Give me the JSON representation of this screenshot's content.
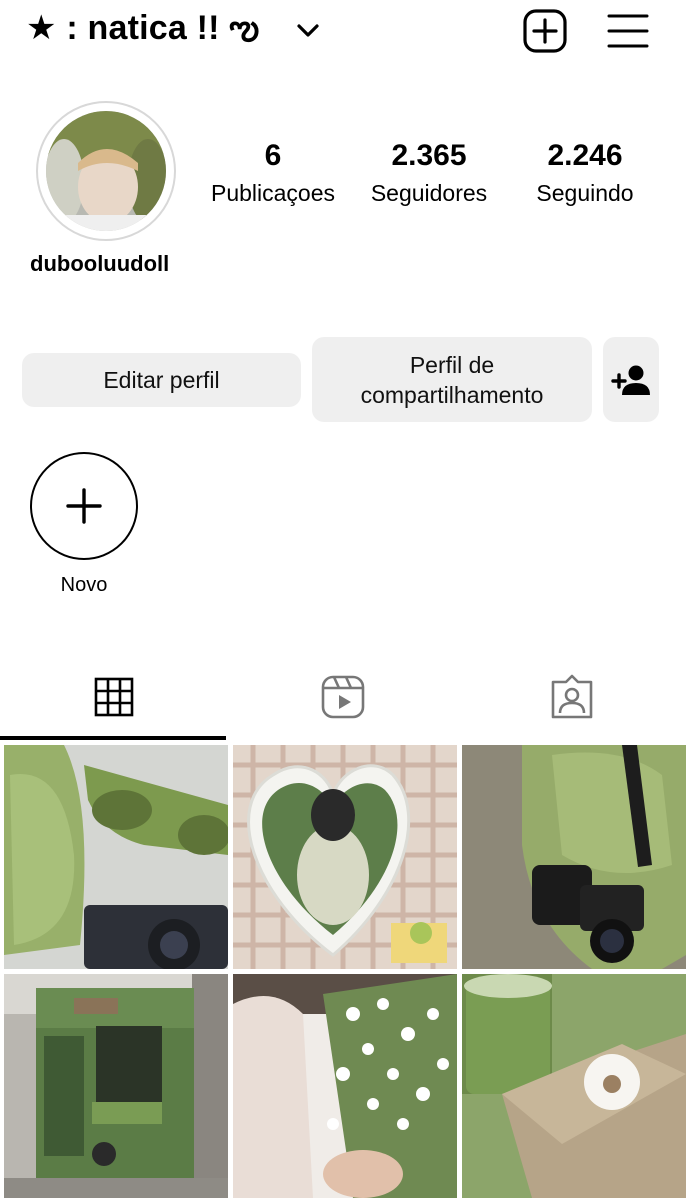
{
  "header": {
    "title": "★ : natica !! ఌ",
    "icons": [
      "chevron-down-icon",
      "create-post-icon",
      "menu-icon"
    ]
  },
  "profile": {
    "handle": "dubooluudoll",
    "stats": [
      {
        "value": "6",
        "label": "Publicaçoes"
      },
      {
        "value": "2.365",
        "label": "Seguidores"
      },
      {
        "value": "2.246",
        "label": "Seguindo"
      }
    ]
  },
  "actions": {
    "edit": "Editar perfil",
    "share_line1": "Perfil de",
    "share_line2": "compartilhamento",
    "add_user_icon": "add-user-icon"
  },
  "highlights": {
    "new_label": "Novo"
  },
  "tabs": [
    "grid-icon",
    "reels-icon",
    "tagged-icon"
  ],
  "colors": {
    "button_bg": "#efefef",
    "accent": "#000000",
    "matcha": "#8ca56a"
  }
}
